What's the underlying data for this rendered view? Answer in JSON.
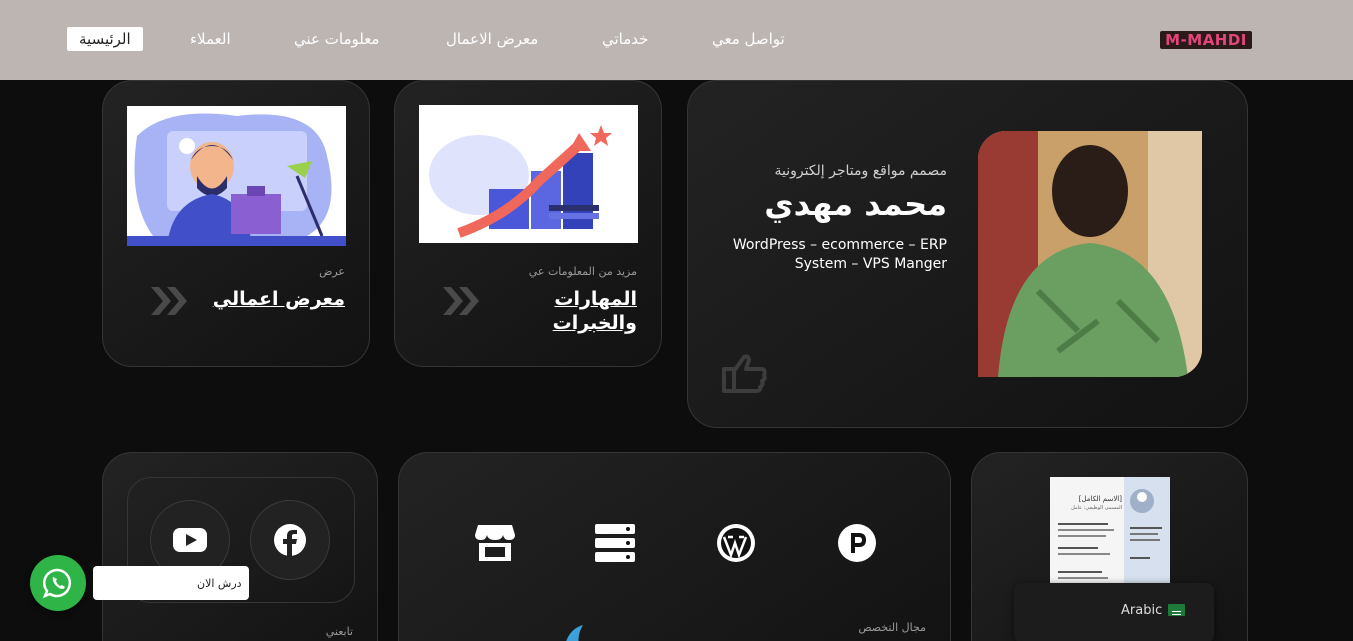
{
  "header": {
    "logo": "M-MAHDI",
    "nav": [
      "الرئيسية",
      "العملاء",
      "معلومات عني",
      "معرض الاعمال",
      "خدماتي",
      "تواصل معي"
    ]
  },
  "hero": {
    "subtitle": "مصمم مواقع ومتاجر إلكترونية",
    "name": "محمد مهدي",
    "description": "WordPress – ecommerce – ERP System – VPS Manger"
  },
  "skills_card": {
    "label": "مزيد من المعلومات عي",
    "title": "المهارات والخبرات"
  },
  "works_card": {
    "label": "عرض",
    "title": "معرض اعمالي"
  },
  "social_card": {
    "label": "تابعني"
  },
  "spec_card": {
    "label": "مجال التخصص"
  },
  "cv_card": {
    "cv_name": "[الاسم الكامل]",
    "cv_role": "المسمى الوظيفي: عامل"
  },
  "language": {
    "label": "Arabic"
  },
  "whatsapp": {
    "label": "درش الان"
  },
  "icons": {
    "thumb": "hand-point-icon",
    "chevrons": "double-chevron-icon",
    "facebook": "facebook-icon",
    "youtube": "youtube-icon",
    "store": "store-icon",
    "server": "server-icon",
    "wordpress": "wordpress-icon",
    "parking": "p-icon",
    "whatsapp": "whatsapp-icon"
  },
  "colors": {
    "header_bg": "#bdb5b2",
    "page_bg": "#0d0d0d",
    "logo_pink": "#e4457a",
    "whatsapp_green": "#2fb448"
  }
}
